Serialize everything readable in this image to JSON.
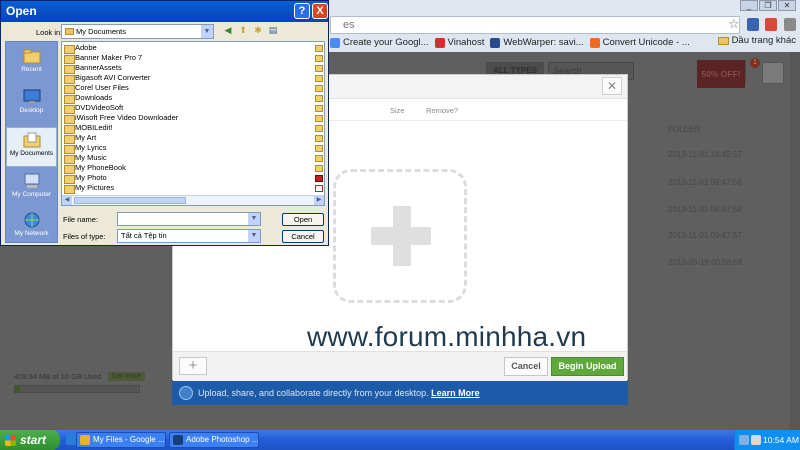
{
  "browser": {
    "address_text": "es",
    "bookmarks": [
      {
        "label": "Create your Googl...",
        "color": "#4a8af4"
      },
      {
        "label": "Vinahost",
        "color": "#d32f2f"
      },
      {
        "label": "WebWarper: savi...",
        "color": "#2b4a8c"
      },
      {
        "label": "Convert Unicode - ...",
        "color": "#f06b1f"
      }
    ],
    "bookmarks_more": "»",
    "bookmark_folder": "Dầu trang khác"
  },
  "app": {
    "all_types_label": "ALL TYPES",
    "search_placeholder": "Search",
    "offer_label": "50% OFF!",
    "notification_count": "1",
    "dates": [
      "FOLDER",
      "2013-11-01 14:45:57",
      "2013-11-01 09:47:58",
      "2013-11-01 09:47:58",
      "2013-11-01 09:47:57",
      "2013-05-19 00:56:58"
    ],
    "quota_text": "409.94 MB of 10 GB Used",
    "quota_upgrade": "Get more",
    "quota_percent": 4
  },
  "upload": {
    "col_size": "Size",
    "col_remove": "Remove?",
    "cancel_label": "Cancel",
    "begin_label": "Begin Upload",
    "promo_text": "Upload, share, and collaborate directly from your desktop. ",
    "promo_link": "Learn More",
    "watermark": "www.forum.minhha.vn"
  },
  "dialog": {
    "title": "Open",
    "help_label": "?",
    "close_label": "X",
    "look_in_label": "Look in:",
    "look_in_value": "My Documents",
    "places": [
      "Recent",
      "Desktop",
      "My Documents",
      "My Computer",
      "My Network"
    ],
    "files": [
      "Adobe",
      "Banner Maker Pro 7",
      "BannerAssets",
      "Bigasoft AVI Converter",
      "Corel User Files",
      "Downloads",
      "DVDVideoSoft",
      "iWisoft Free Video Downloader",
      "MOBILedit!",
      "My Art",
      "My Lyrics",
      "My Music",
      "My PhoneBook",
      "My Photo",
      "My Pictures"
    ],
    "file_name_label": "File name:",
    "file_name_value": "",
    "files_of_type_label": "Files of type:",
    "files_of_type_value": "Tất cả Tệp tin",
    "open_label": "Open",
    "cancel_label": "Cancel"
  },
  "taskbar": {
    "start_label": "start",
    "tasks": [
      {
        "label": "My Files - Google ...",
        "color": "#e8b430"
      },
      {
        "label": "Adobe Photoshop ...",
        "color": "#1b3d78"
      }
    ],
    "clock": "10:54 AM"
  }
}
